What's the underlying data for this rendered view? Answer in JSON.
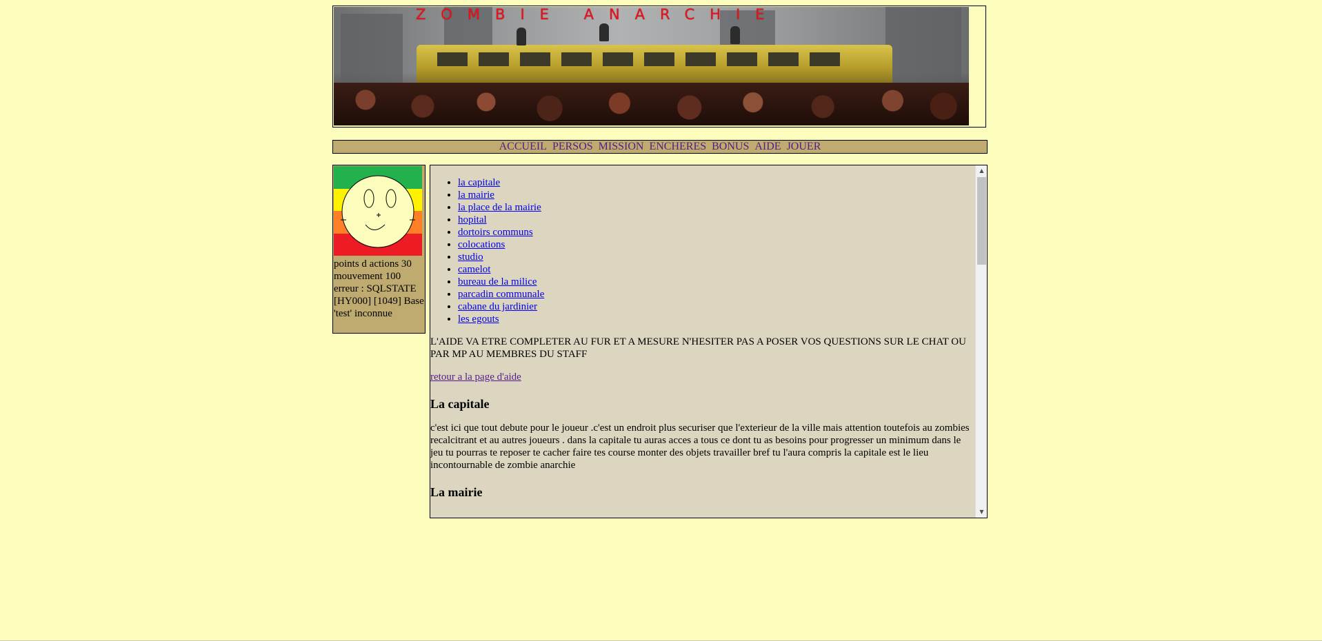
{
  "banner": {
    "title": "ZOMBIE ANARCHIE"
  },
  "nav": {
    "items": [
      "ACCUEIL",
      "PERSOS",
      "MISSION",
      "ENCHERES",
      "BONUS",
      "AIDE",
      "JOUER"
    ]
  },
  "sidebar": {
    "avatar_icon": "smiley-face-icon",
    "avatar_band_colors": [
      "#22b14c",
      "#fff200",
      "#ff7f27",
      "#ed1c24"
    ],
    "action_points": "points d actions 30",
    "movement": "mouvement 100",
    "error_text": "erreur : SQLSTATE[HY000] [1049] Base 'test' inconnue"
  },
  "main": {
    "locations": [
      "la capitale",
      "la mairie",
      "la place de la mairie",
      "hopital",
      "dortoirs communs",
      "colocations",
      "studio",
      "camelot",
      "bureau de la milice",
      "parcadin communale",
      "cabane du jardinier",
      "les egouts"
    ],
    "notice": "L'AIDE VA ETRE COMPLETER AU FUR ET A MESURE N'HESITER PAS A POSER VOS QUESTIONS SUR LE CHAT OU PAR MP AU MEMBRES DU STAFF",
    "back_link": "retour a la page d'aide",
    "sections": [
      {
        "heading": "La capitale",
        "body": "c'est ici que tout debute pour le joueur .c'est un endroit plus securiser que l'exterieur de la ville mais attention toutefois au zombies recalcitrant et au autres joueurs . dans la capitale tu auras acces a tous ce dont tu as besoins pour progresser un minimum dans le jeu tu pourras te reposer te cacher faire tes course monter des objets travailler bref tu l'aura compris la capitale est le lieu incontournable de zombie anarchie"
      },
      {
        "heading": "La mairie",
        "body": ""
      }
    ]
  },
  "scrollbar": {
    "up_icon": "scroll-up-arrow-icon",
    "down_icon": "scroll-down-arrow-icon",
    "up_glyph": "▲",
    "down_glyph": "▼"
  }
}
